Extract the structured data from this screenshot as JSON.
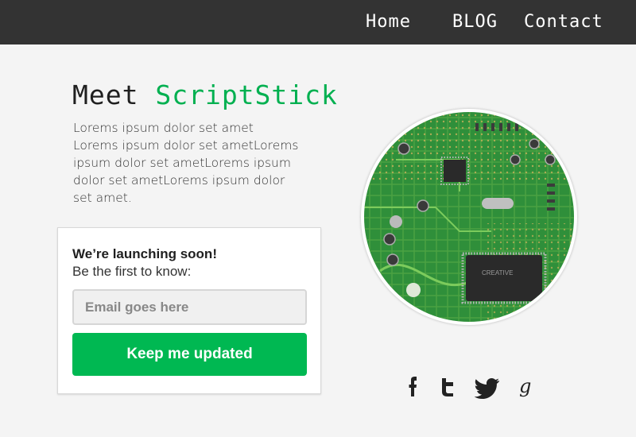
{
  "nav": {
    "home": "Home",
    "blog": "BLOG",
    "contact": "Contact"
  },
  "hero": {
    "title_part1": "Meet ",
    "title_part2": "ScriptStick",
    "intro": "Lorems ipsum dolor set amet Lorems ipsum dolor set ametLorems ipsum dolor set ametLorems ipsum dolor set ametLorems ipsum dolor set amet."
  },
  "signup": {
    "title": "We’re launching soon!",
    "subtitle": "Be the first to know:",
    "email_placeholder": "Email goes here",
    "email_value": "",
    "button_label": "Keep me updated"
  },
  "image": {
    "chip_label": "CREATIVE"
  },
  "social": [
    {
      "icon": "facebook-icon"
    },
    {
      "icon": "tumblr-icon"
    },
    {
      "icon": "twitter-icon"
    },
    {
      "icon": "google-icon"
    }
  ],
  "colors": {
    "topbar": "#333333",
    "brand_green": "#00b050",
    "button_green": "#00b852",
    "background": "#f4f4f4"
  }
}
